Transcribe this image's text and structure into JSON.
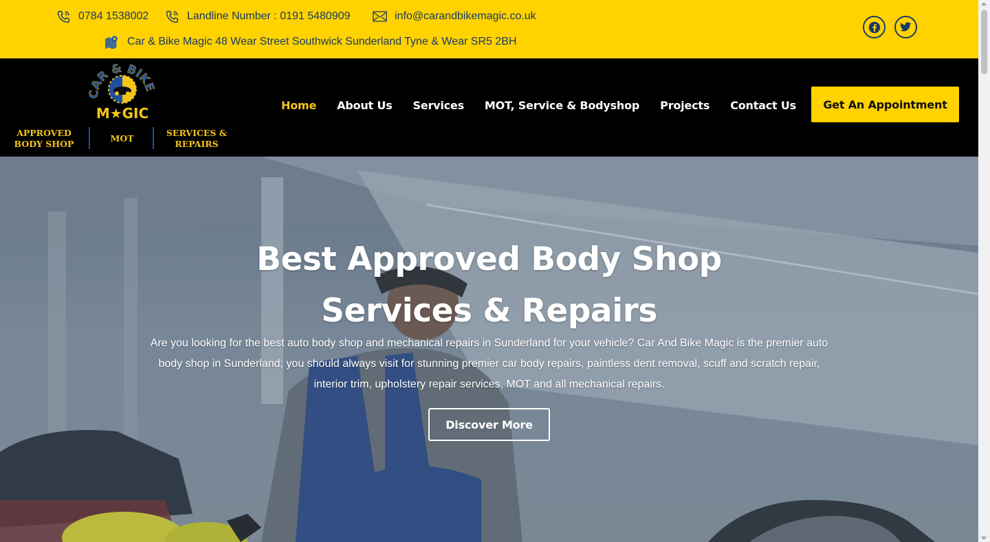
{
  "topbar": {
    "phone": "0784 1538002",
    "landline": "Landline Number : 0191 5480909",
    "email": "info@carandbikemagic.co.uk",
    "address": "Car & Bike Magic 48 Wear Street Southwick Sunderland Tyne & Wear SR5 2BH",
    "icons": [
      "phone-icon",
      "phone-icon",
      "mail-icon",
      "map-icon"
    ],
    "social": [
      "facebook-icon",
      "twitter-icon"
    ]
  },
  "logo": {
    "arc_text": "CAR & BIKE",
    "wordmark": "M★GIC",
    "badges": [
      "APPROVED BODY SHOP",
      "MOT",
      "SERVICES & REPAIRS"
    ]
  },
  "nav": {
    "items": [
      "Home",
      "About Us",
      "Services",
      "MOT, Service & Bodyshop",
      "Projects",
      "Contact Us"
    ],
    "active": "Home"
  },
  "cta": {
    "label": "Get An Appointment"
  },
  "hero": {
    "title_line1": "Best Approved Body Shop",
    "title_line2": "Services & Repairs",
    "text": "Are you looking for the best auto body shop and mechanical repairs in Sunderland for your vehicle? Car And Bike Magic is the premier auto body shop in Sunderland; you should always visit for stunning premier car body repairs, paintless dent removal, scuff and scratch repair, interior trim, upholstery repair services, MOT and all mechanical repairs.",
    "button": "Discover More"
  },
  "colors": {
    "accent": "#FFD200",
    "header_bg": "#000000",
    "contact_text": "#1a3a66",
    "nav_active": "#F5C518"
  }
}
